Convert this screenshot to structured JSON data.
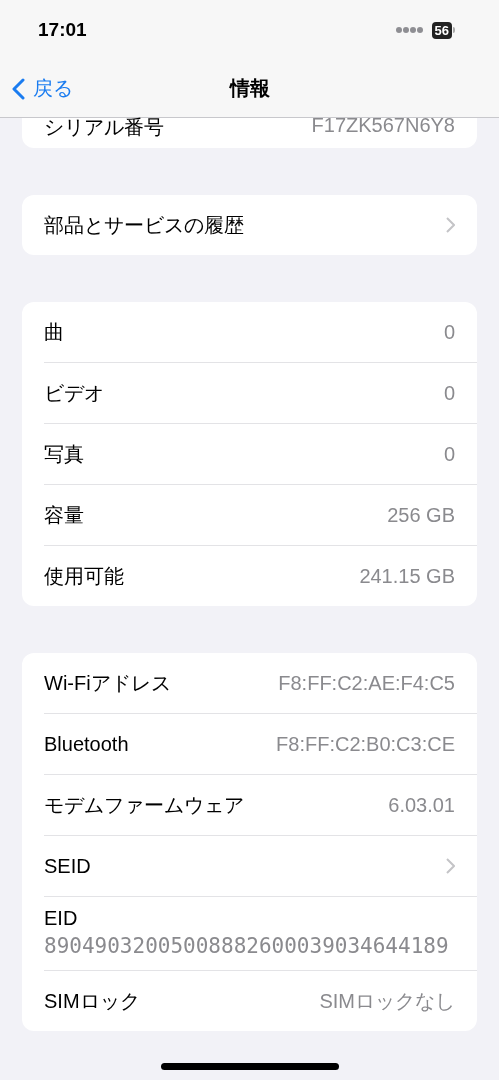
{
  "status_bar": {
    "time": "17:01",
    "battery": "56"
  },
  "nav_bar": {
    "back": "戻る",
    "title": "情報"
  },
  "groups": [
    {
      "rows": [
        {
          "kind": "value",
          "label": "シリアル番号",
          "value": "F17ZK567N6Y8",
          "clipped": true
        }
      ]
    },
    {
      "rows": [
        {
          "kind": "link",
          "label": "部品とサービスの履歴"
        }
      ]
    },
    {
      "rows": [
        {
          "kind": "value",
          "label": "曲",
          "value": "0"
        },
        {
          "kind": "value",
          "label": "ビデオ",
          "value": "0"
        },
        {
          "kind": "value",
          "label": "写真",
          "value": "0"
        },
        {
          "kind": "value",
          "label": "容量",
          "value": "256 GB"
        },
        {
          "kind": "value",
          "label": "使用可能",
          "value": "241.15 GB"
        }
      ]
    },
    {
      "rows": [
        {
          "kind": "value",
          "label": "Wi-Fiアドレス",
          "value": "F8:FF:C2:AE:F4:C5"
        },
        {
          "kind": "value",
          "label": "Bluetooth",
          "value": "F8:FF:C2:B0:C3:CE"
        },
        {
          "kind": "value",
          "label": "モデムファームウェア",
          "value": "6.03.01"
        },
        {
          "kind": "link",
          "label": "SEID"
        },
        {
          "kind": "stacked",
          "label": "EID",
          "value": "89049032005008882600039034644189"
        },
        {
          "kind": "value",
          "label": "SIMロック",
          "value": "SIMロックなし"
        }
      ]
    }
  ]
}
